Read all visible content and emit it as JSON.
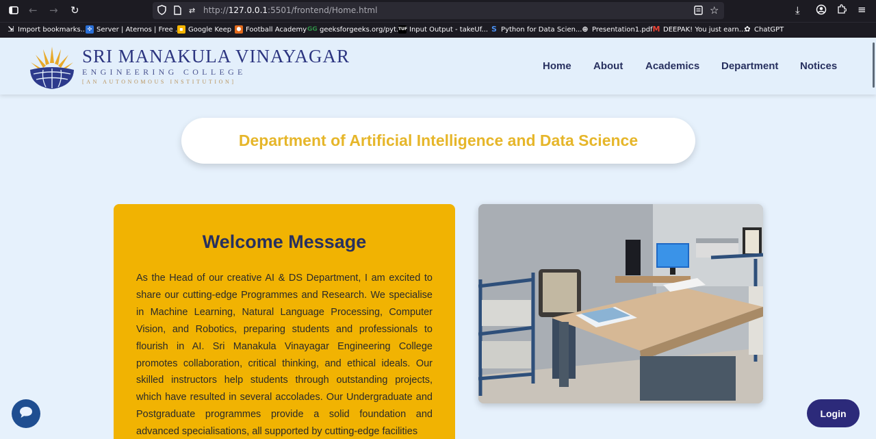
{
  "browser": {
    "url_prefix": "http://",
    "url_host": "127.0.0.1",
    "url_path": ":5501/frontend/Home.html",
    "bookmarks": [
      {
        "label": "Import bookmarks...",
        "icon": "import-icon"
      },
      {
        "label": "Server | Aternos | Free ...",
        "icon": "aternos-icon"
      },
      {
        "label": "Google Keep",
        "icon": "keep-icon"
      },
      {
        "label": "Football Academy",
        "icon": "football-icon"
      },
      {
        "label": "geeksforgeeks.org/pyt...",
        "icon": "gfg-icon"
      },
      {
        "label": "Input Output - takeUf...",
        "icon": "takeuforward-icon"
      },
      {
        "label": "Python for Data Scien...",
        "icon": "python-icon"
      },
      {
        "label": "Presentation1.pdf",
        "icon": "globe-icon"
      },
      {
        "label": "DEEPAK! You just earn...",
        "icon": "gmail-icon"
      },
      {
        "label": "ChatGPT",
        "icon": "chatgpt-icon"
      }
    ]
  },
  "header": {
    "brand_title": "SRI MANAKULA VINAYAGAR",
    "brand_subtitle": "ENGINEERING COLLEGE",
    "brand_tagline": "[AN AUTONOMOUS INSTITUTION]",
    "nav": [
      "Home",
      "About",
      "Academics",
      "Department",
      "Notices"
    ]
  },
  "department": {
    "title": "Department of Artificial Intelligence and Data Science"
  },
  "welcome": {
    "heading": "Welcome Message",
    "body": "As the Head of our creative AI & DS Department, I am excited to share our cutting-edge Programmes and Research. We specialise in Machine Learning, Natural Language Processing, Computer Vision, and Robotics, preparing students and professionals to flourish in AI. Sri Manakula Vinayagar Engineering College promotes collaboration, critical thinking, and ethical ideals. Our skilled instructors help students through outstanding projects, which have resulted in several accolades. Our Undergraduate and Postgraduate programmes provide a solid foundation and advanced specialisations, all supported by cutting-edge facilities"
  },
  "actions": {
    "login_label": "Login",
    "chat_icon": "chat-bubble-icon"
  },
  "colors": {
    "accent_gold": "#f1b302",
    "navy": "#27305f",
    "dept_title": "#e6b62a",
    "login_bg": "#2c2a7a"
  }
}
